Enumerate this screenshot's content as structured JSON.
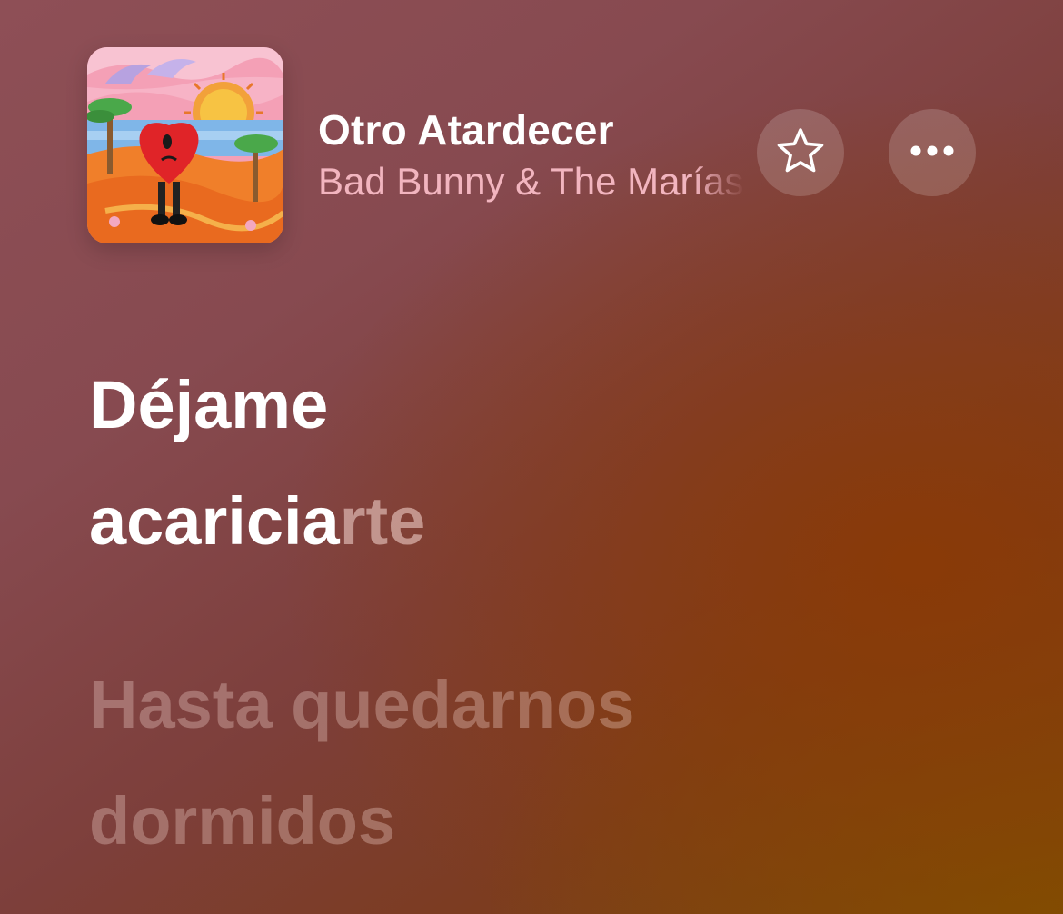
{
  "now_playing": {
    "title": "Otro Atardecer",
    "artist": "Bad Bunny & The Marías",
    "artwork_icon": "album-artwork-heart-beach",
    "buttons": {
      "favorite_icon": "star-outline-icon",
      "more_icon": "ellipsis-icon"
    }
  },
  "lyrics": {
    "current": {
      "line1": "Déjame",
      "line2_sung": "acaricia",
      "line2_unsung": "rte"
    },
    "next": {
      "line1": "Hasta quedarnos",
      "line2": "dormidos"
    }
  },
  "colors": {
    "background_top": "#8e4f56",
    "background_bottom": "#7a4410",
    "title": "#ffffff",
    "artist": "#f2b5bf"
  }
}
